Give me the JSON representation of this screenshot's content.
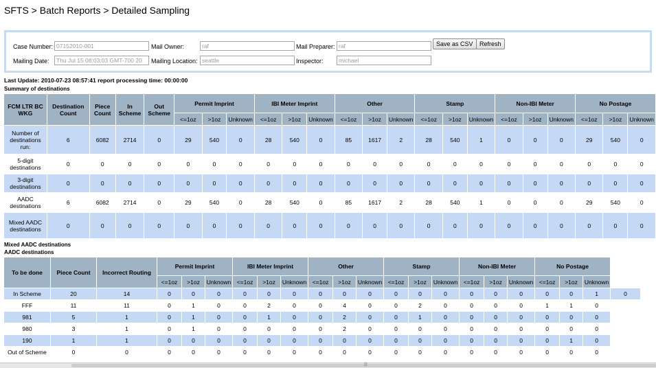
{
  "header": {
    "breadcrumb": "SFTS > Batch Reports > Detailed Sampling"
  },
  "form": {
    "case_number_label": "Case Number:",
    "case_number_value": "07152010-001",
    "mail_owner_label": "Mail Owner:",
    "mail_owner_value": "raf",
    "mail_preparer_label": "Mail Preparer:",
    "mail_preparer_value": "raf",
    "mailing_date_label": "Mailing Date:",
    "mailing_date_value": "Thu Jul 15 08:03:03 GMT-700 20",
    "mailing_location_label": "Mailing Location:",
    "mailing_location_value": "seattle",
    "inspector_label": "Inspector:",
    "inspector_value": "michael",
    "save_csv_label": "Save as CSV",
    "refresh_label": "Refresh"
  },
  "status": {
    "last_update": "Last Update: 2010-07-23 08:57:41 report processing time: 00:00:00"
  },
  "summary": {
    "title": "Summary of destinations",
    "main_headers": [
      "FCM LTR BC WKG",
      "Destination Count",
      "Piece Count",
      "In Scheme",
      "Out Scheme"
    ],
    "groups": [
      "Permit Imprint",
      "IBI Meter Imprint",
      "Other",
      "Stamp",
      "Non-IBI Meter",
      "No Postage"
    ],
    "sub_headers": [
      "<=1oz",
      ">1oz",
      "Unknown"
    ],
    "rows": [
      {
        "label": "Number of destinations run:",
        "values": [
          "6",
          "6082",
          "2714",
          "0",
          "29",
          "540",
          "0",
          "28",
          "540",
          "0",
          "85",
          "1617",
          "2",
          "28",
          "540",
          "1",
          "0",
          "0",
          "0",
          "29",
          "540",
          "0"
        ]
      },
      {
        "label": "5-digit destinations",
        "values": [
          "0",
          "0",
          "0",
          "0",
          "0",
          "0",
          "0",
          "0",
          "0",
          "0",
          "0",
          "0",
          "0",
          "0",
          "0",
          "0",
          "0",
          "0",
          "0",
          "0",
          "0",
          "0"
        ]
      },
      {
        "label": "3-digit destinations",
        "values": [
          "0",
          "0",
          "0",
          "0",
          "0",
          "0",
          "0",
          "0",
          "0",
          "0",
          "0",
          "0",
          "0",
          "0",
          "0",
          "0",
          "0",
          "0",
          "0",
          "0",
          "0",
          "0"
        ]
      },
      {
        "label": "AADC destinations",
        "values": [
          "6",
          "6082",
          "2714",
          "0",
          "29",
          "540",
          "0",
          "28",
          "540",
          "0",
          "85",
          "1617",
          "2",
          "28",
          "540",
          "1",
          "0",
          "0",
          "0",
          "29",
          "540",
          "0"
        ]
      },
      {
        "label": "Mixed AADC destinations",
        "values": [
          "0",
          "0",
          "0",
          "0",
          "0",
          "0",
          "0",
          "0",
          "0",
          "0",
          "0",
          "0",
          "0",
          "0",
          "0",
          "0",
          "0",
          "0",
          "0",
          "0",
          "0",
          "0"
        ]
      }
    ]
  },
  "detail": {
    "title_mixed": "Mixed AADC destinations",
    "title_aadc": "AADC destinations",
    "main_headers": [
      "To be done",
      "Piece Count",
      "Incorrect Routing"
    ],
    "groups": [
      "Permit Imprint",
      "IBI Meter Imprint",
      "Other",
      "Stamp",
      "Non-IBI Meter",
      "No Postage"
    ],
    "sub_headers": [
      "<=1oz",
      ">1oz",
      "Unknown"
    ],
    "rows": [
      {
        "label": "In Scheme",
        "values": [
          "20",
          "14",
          "0",
          "0",
          "0",
          "0",
          "0",
          "0",
          "0",
          "0",
          "0",
          "0",
          "0",
          "0",
          "0",
          "0",
          "0",
          "0",
          "0",
          "1",
          "0"
        ]
      },
      {
        "label": "FFF",
        "values": [
          "11",
          "11",
          "0",
          "1",
          "0",
          "0",
          "2",
          "0",
          "0",
          "4",
          "0",
          "0",
          "2",
          "0",
          "0",
          "0",
          "0",
          "1",
          "1",
          "0"
        ]
      },
      {
        "label": "981",
        "values": [
          "5",
          "1",
          "0",
          "1",
          "0",
          "0",
          "1",
          "0",
          "0",
          "2",
          "0",
          "0",
          "1",
          "0",
          "0",
          "0",
          "0",
          "0",
          "0",
          "0"
        ]
      },
      {
        "label": "980",
        "values": [
          "3",
          "1",
          "0",
          "1",
          "0",
          "0",
          "0",
          "0",
          "0",
          "2",
          "0",
          "0",
          "0",
          "0",
          "0",
          "0",
          "0",
          "0",
          "0",
          "0"
        ]
      },
      {
        "label": "190",
        "values": [
          "1",
          "1",
          "0",
          "0",
          "0",
          "0",
          "0",
          "0",
          "0",
          "0",
          "0",
          "0",
          "0",
          "0",
          "0",
          "0",
          "0",
          "0",
          "1",
          "0"
        ]
      },
      {
        "label": "Out of Scheme",
        "values": [
          "0",
          "0",
          "0",
          "0",
          "0",
          "0",
          "0",
          "0",
          "0",
          "0",
          "0",
          "0",
          "0",
          "0",
          "0",
          "0",
          "0",
          "0",
          "0",
          "0"
        ]
      }
    ]
  },
  "colors": {
    "header_bg": "#9fb3c5",
    "row_odd_bg": "#c5d9f5",
    "row_even_bg": "#ffffff",
    "form_border": "#c7daf0"
  },
  "icons": {
    "scroll_grip": "scroll-grip-icon"
  }
}
